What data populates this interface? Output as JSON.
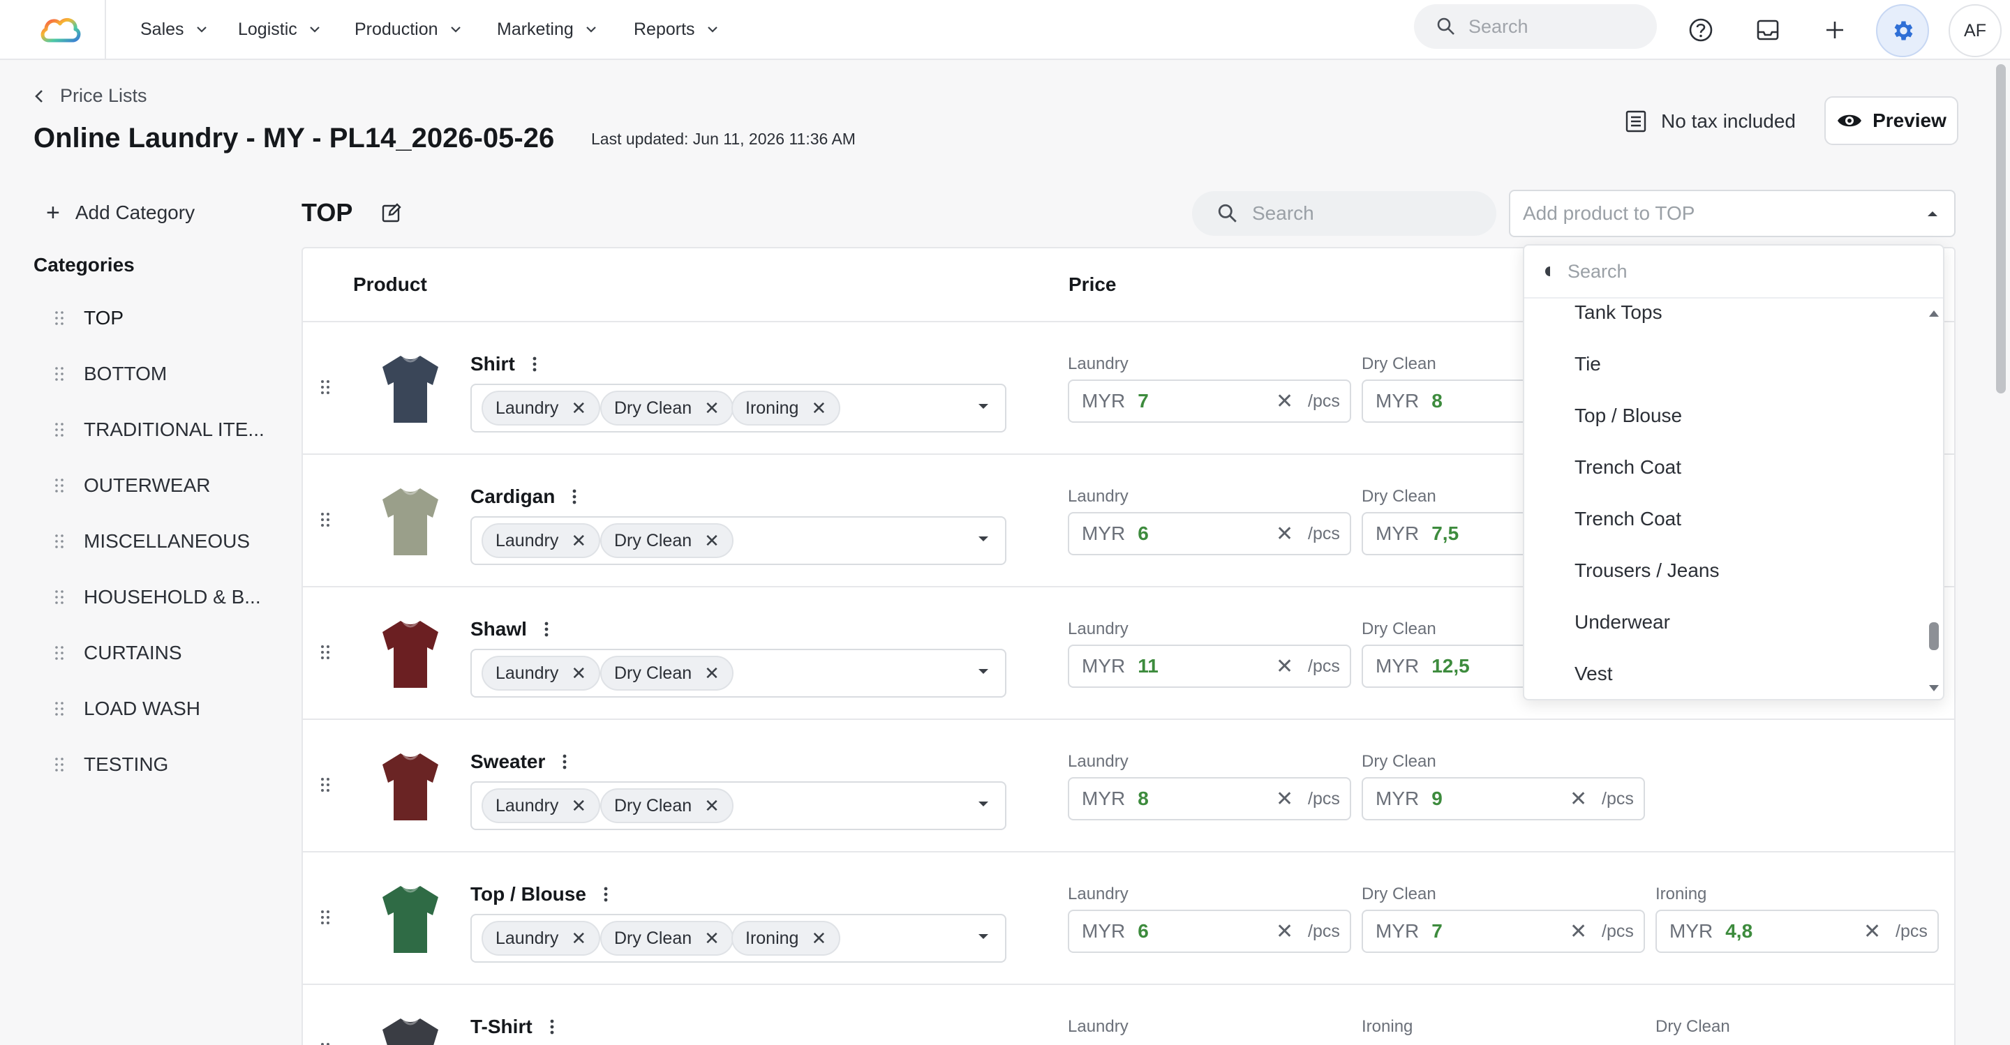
{
  "nav": {
    "items": [
      "Sales",
      "Logistic",
      "Production",
      "Marketing",
      "Reports"
    ],
    "search_placeholder": "Search",
    "avatar_initials": "AF"
  },
  "header": {
    "back_label": "Price Lists",
    "title": "Online Laundry - MY - PL14_2026-05-26",
    "last_updated": "Last updated: Jun 11, 2026 11:36 AM",
    "tax_label": "No tax included",
    "preview_label": "Preview"
  },
  "sidebar": {
    "add_category_label": "Add Category",
    "heading": "Categories",
    "items": [
      "TOP",
      "BOTTOM",
      "TRADITIONAL ITE...",
      "OUTERWEAR",
      "MISCELLANEOUS",
      "HOUSEHOLD & B...",
      "CURTAINS",
      "LOAD WASH",
      "TESTING"
    ]
  },
  "main": {
    "section_title": "TOP",
    "search_placeholder": "Search",
    "add_product_placeholder": "Add product to TOP",
    "columns": {
      "product": "Product",
      "price": "Price"
    },
    "rows": [
      {
        "name": "Shirt",
        "tags": [
          "Laundry",
          "Dry Clean",
          "Ironing"
        ],
        "prices": [
          {
            "label": "Laundry",
            "currency": "MYR",
            "value": "7",
            "unit": "/pcs"
          },
          {
            "label": "Dry Clean",
            "currency": "MYR",
            "value": "8",
            "unit": "/pcs"
          }
        ]
      },
      {
        "name": "Cardigan",
        "tags": [
          "Laundry",
          "Dry Clean"
        ],
        "prices": [
          {
            "label": "Laundry",
            "currency": "MYR",
            "value": "6",
            "unit": "/pcs"
          },
          {
            "label": "Dry Clean",
            "currency": "MYR",
            "value": "7,5",
            "unit": "/pcs"
          }
        ]
      },
      {
        "name": "Shawl",
        "tags": [
          "Laundry",
          "Dry Clean"
        ],
        "prices": [
          {
            "label": "Laundry",
            "currency": "MYR",
            "value": "11",
            "unit": "/pcs"
          },
          {
            "label": "Dry Clean",
            "currency": "MYR",
            "value": "12,5",
            "unit": "/pcs"
          }
        ]
      },
      {
        "name": "Sweater",
        "tags": [
          "Laundry",
          "Dry Clean"
        ],
        "prices": [
          {
            "label": "Laundry",
            "currency": "MYR",
            "value": "8",
            "unit": "/pcs"
          },
          {
            "label": "Dry Clean",
            "currency": "MYR",
            "value": "9",
            "unit": "/pcs"
          }
        ]
      },
      {
        "name": "Top / Blouse",
        "tags": [
          "Laundry",
          "Dry Clean",
          "Ironing"
        ],
        "prices": [
          {
            "label": "Laundry",
            "currency": "MYR",
            "value": "6",
            "unit": "/pcs"
          },
          {
            "label": "Dry Clean",
            "currency": "MYR",
            "value": "7",
            "unit": "/pcs"
          },
          {
            "label": "Ironing",
            "currency": "MYR",
            "value": "4,8",
            "unit": "/pcs"
          }
        ]
      },
      {
        "name": "T-Shirt",
        "tags": [],
        "price_labels": [
          "Laundry",
          "Ironing",
          "Dry Clean"
        ]
      }
    ]
  },
  "dropdown": {
    "search_placeholder": "Search",
    "items": [
      "Tank Tops",
      "Tie",
      "Top / Blouse",
      "Trench Coat",
      "Trench Coat",
      "Trousers / Jeans",
      "Underwear",
      "Vest"
    ]
  },
  "colors": {
    "accent": "#2f6fd6",
    "price_value": "#3d8b3d",
    "border": "#d9dce0"
  }
}
